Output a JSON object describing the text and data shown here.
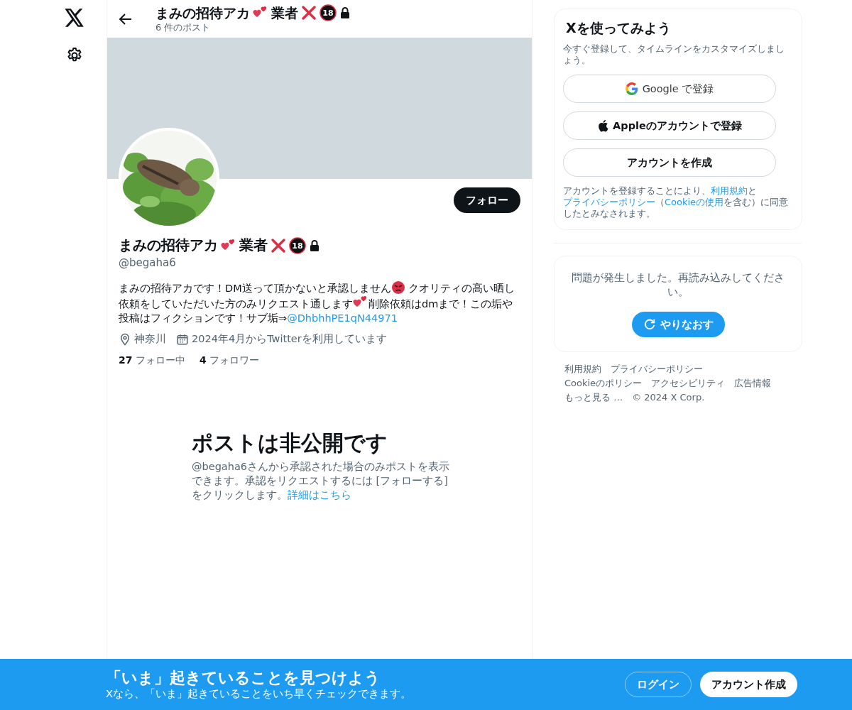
{
  "header": {
    "name": [
      {
        "kind": "text",
        "text": "まみの招待アカ"
      },
      {
        "kind": "hearts"
      },
      {
        "kind": "text",
        "text": "業者"
      },
      {
        "kind": "cross"
      },
      {
        "kind": "age",
        "text": "18"
      }
    ],
    "protected": true,
    "post_count": "6 件のポスト"
  },
  "profile": {
    "name": [
      {
        "kind": "text",
        "text": "まみの招待アカ"
      },
      {
        "kind": "hearts"
      },
      {
        "kind": "text",
        "text": "業者"
      },
      {
        "kind": "cross"
      },
      {
        "kind": "age",
        "text": "18"
      }
    ],
    "protected": true,
    "handle": "@begaha6",
    "follow_button": "フォロー",
    "bio": [
      {
        "kind": "text",
        "text": "まみの招待アカです！DM送って頂かないと承認しません"
      },
      {
        "kind": "angry"
      },
      {
        "kind": "text",
        "text": " クオリティの高い晒し依頼をしていただいた方のみリクエスト通します"
      },
      {
        "kind": "hearts"
      },
      {
        "kind": "text",
        "text": "削除依頼はdmまで！この垢や投稿はフィクションです！サブ垢⇒"
      },
      {
        "kind": "link",
        "text": "@DhbhhPE1qN44971"
      }
    ],
    "location": "神奈川",
    "joined": "2024年4月からTwitterを利用しています",
    "stats": [
      {
        "count": "27",
        "label": "フォロー中"
      },
      {
        "count": "4",
        "label": "フォロワー"
      }
    ]
  },
  "private": {
    "title": "ポストは非公開です",
    "text": "@begaha6さんから承認された場合のみポストを表示できます。承認をリクエストするには [フォローする] をクリックします。",
    "link": "詳細はこちら"
  },
  "signup": {
    "title": "Xを使ってみよう",
    "subtitle": "今すぐ登録して、タイムラインをカスタマイズしましょう。",
    "buttons": [
      {
        "kind": "google",
        "label": "Google で登録"
      },
      {
        "kind": "apple",
        "label": "Appleのアカウントで登録"
      },
      {
        "kind": "plain",
        "label": "アカウントを作成"
      }
    ],
    "terms": [
      {
        "kind": "text",
        "text": "アカウントを登録することにより、"
      },
      {
        "kind": "link",
        "text": "利用規約"
      },
      {
        "kind": "text",
        "text": "と"
      },
      {
        "kind": "link",
        "text": "プライバシーポリシー"
      },
      {
        "kind": "text",
        "text": "（"
      },
      {
        "kind": "link",
        "text": "Cookieの使用"
      },
      {
        "kind": "text",
        "text": "を含む）に同意したとみなされます。"
      }
    ]
  },
  "error": {
    "message": "問題が発生しました。再読み込みしてください。",
    "retry": "やりなおす"
  },
  "footer": [
    "利用規約",
    "プライバシーポリシー",
    "Cookieのポリシー",
    "アクセシビリティ",
    "広告情報",
    "もっと見る …",
    "© 2024 X Corp."
  ],
  "banner": {
    "title": "「いま」起きていることを見つけよう",
    "subtitle": "Xなら、「いま」起きていることをいち早くチェックできます。",
    "login": "ログイン",
    "signup": "アカウント作成"
  }
}
